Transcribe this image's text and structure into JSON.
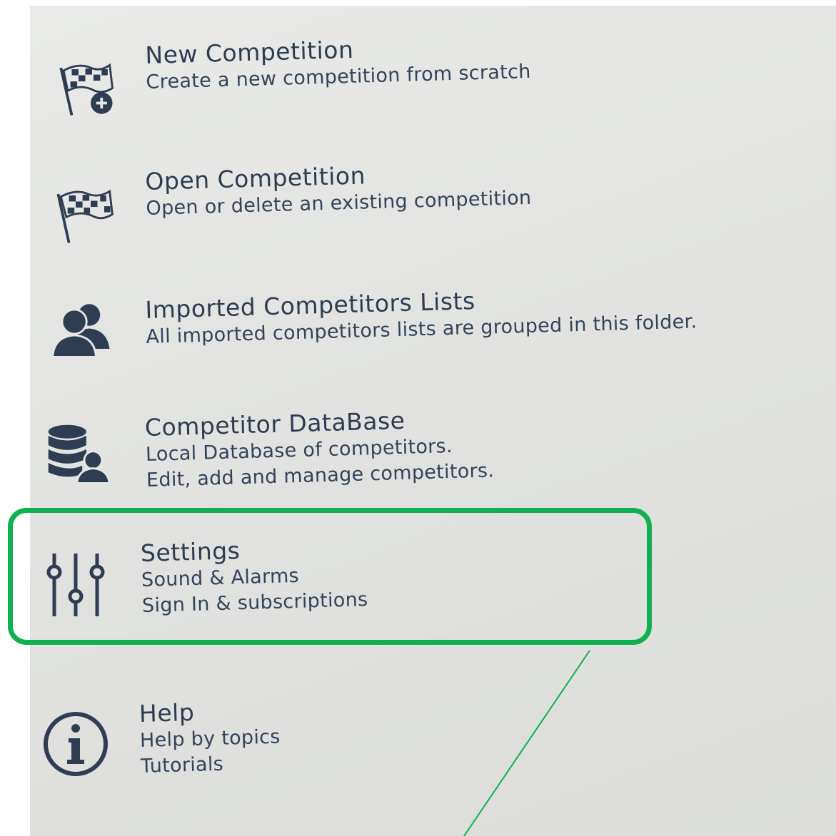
{
  "menu": {
    "items": [
      {
        "title": "New Competition",
        "subtitle": [
          "Create a new competition from scratch"
        ],
        "icon": "checkered-flag-add-icon"
      },
      {
        "title": "Open Competition",
        "subtitle": [
          "Open or delete an existing competition"
        ],
        "icon": "checkered-flag-icon"
      },
      {
        "title": "Imported Competitors Lists",
        "subtitle": [
          "All imported competitors lists are grouped in this folder."
        ],
        "icon": "users-group-icon"
      },
      {
        "title": "Competitor DataBase",
        "subtitle": [
          "Local Database of competitors.",
          "Edit, add and manage competitors."
        ],
        "icon": "database-user-icon"
      },
      {
        "title": "Settings",
        "subtitle": [
          "Sound & Alarms",
          "Sign In & subscriptions"
        ],
        "icon": "sliders-icon"
      },
      {
        "title": "Help",
        "subtitle": [
          "Help by topics",
          "Tutorials"
        ],
        "icon": "info-circle-icon"
      }
    ]
  },
  "colors": {
    "text": "#2e3c50",
    "icon": "#2f3d52",
    "highlight": "#0eb04f",
    "background": "#e4e5e3"
  },
  "annotation": {
    "highlighted_item": "Settings"
  }
}
